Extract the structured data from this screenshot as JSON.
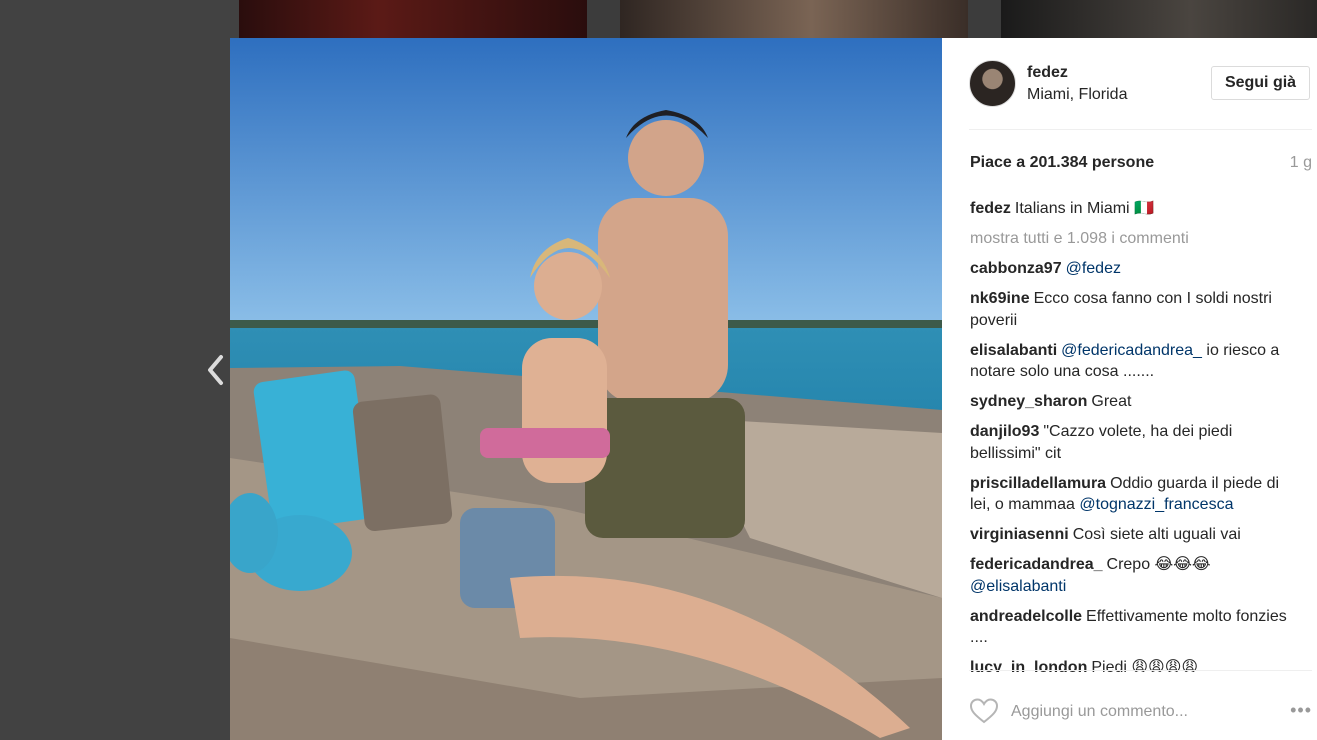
{
  "post": {
    "username": "fedez",
    "location": "Miami, Florida",
    "follow_label": "Segui già",
    "likes": "Piace a 201.384 persone",
    "time": "1 g",
    "view_all": "mostra tutti e 1.098 i commenti",
    "caption": {
      "user": "fedez",
      "text": "Italians in Miami 🇮🇹"
    }
  },
  "comments": [
    {
      "user": "cabbonza97",
      "mention": "@fedez",
      "text": ""
    },
    {
      "user": "nk69ine",
      "text": "Ecco cosa fanno con I soldi nostri poverii"
    },
    {
      "user": "elisalabanti",
      "mention": "@federicadandrea_",
      "text": " io riesco a notare solo una cosa ......."
    },
    {
      "user": "sydney_sharon",
      "text": "Great"
    },
    {
      "user": "danjilo93",
      "text": "\"Cazzo volete, ha dei piedi bellissimi\" cit"
    },
    {
      "user": "priscilladellamura",
      "text": "Oddio guarda il piede di lei, o mammaa ",
      "mention_after": "@tognazzi_francesca"
    },
    {
      "user": "virginiasenni",
      "text": "Così siete alti uguali vai"
    },
    {
      "user": "federicadandrea_",
      "text": "Crepo 😂😂😂 ",
      "mention_after": "@elisalabanti"
    },
    {
      "user": "andreadelcolle",
      "text": "Effettivamente molto fonzies ...."
    },
    {
      "user": "lucy_in_london",
      "text": "Piedi 😩😩😩😩"
    }
  ],
  "add_comment": {
    "placeholder": "Aggiungi un commento...",
    "more_icon": "more-options-icon"
  },
  "icons": {
    "prev": "chevron-left-icon",
    "like": "heart-icon"
  }
}
